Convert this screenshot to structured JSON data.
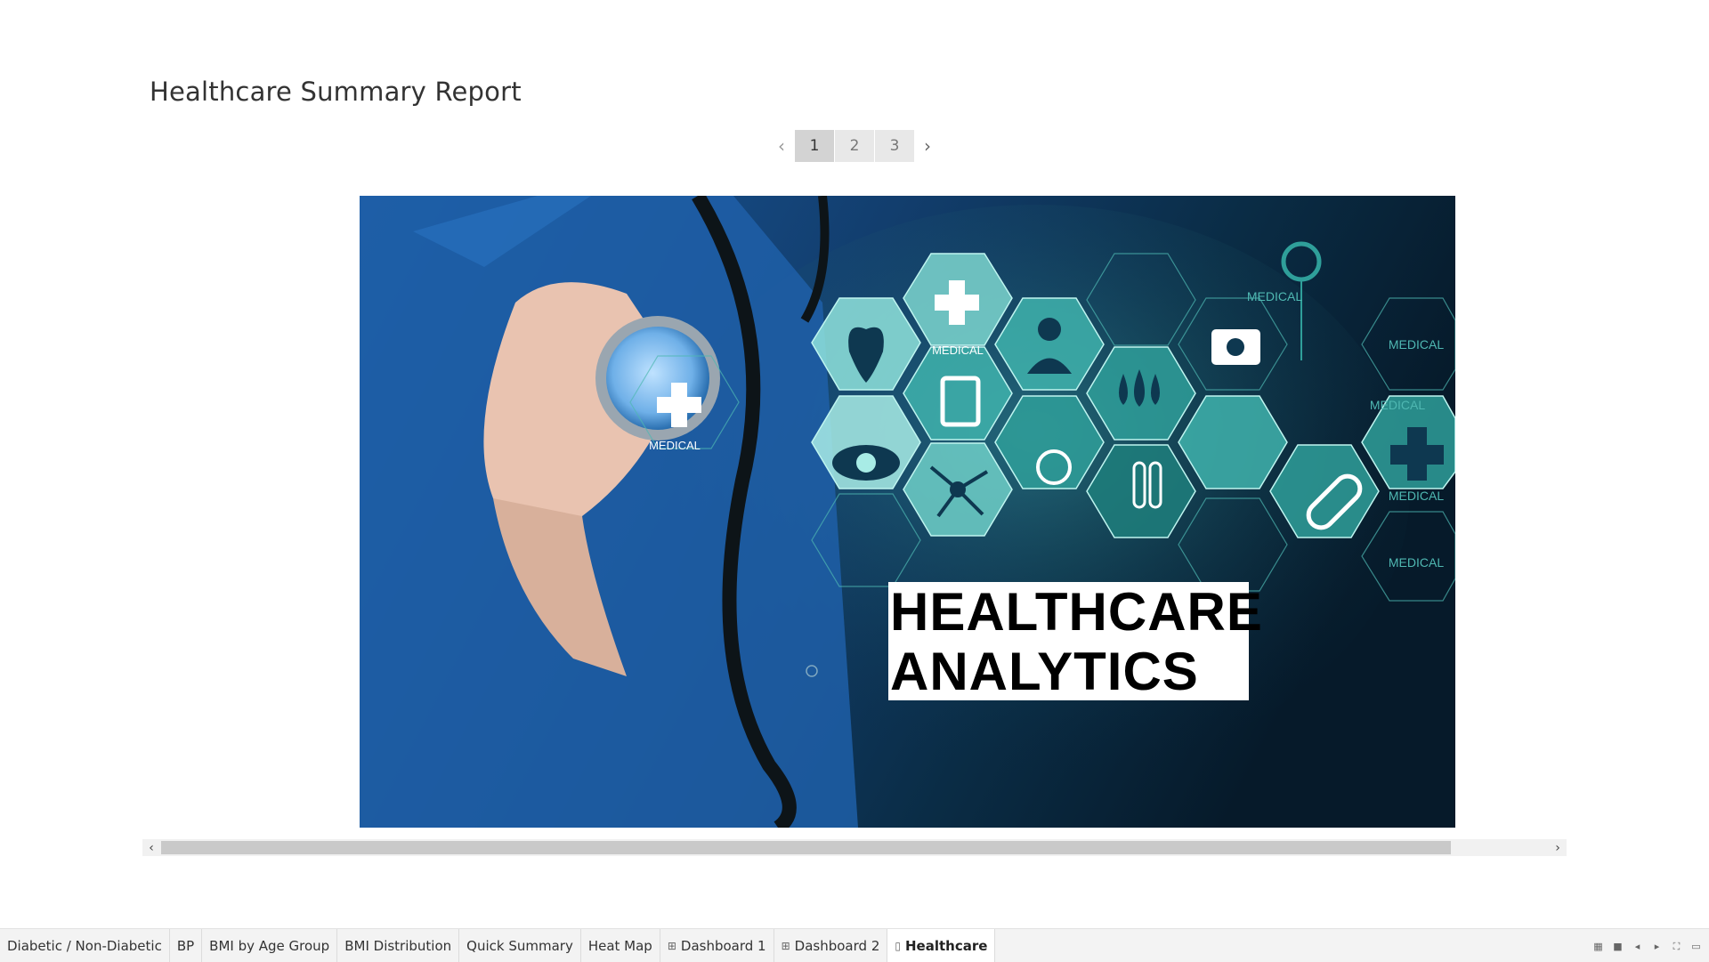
{
  "report": {
    "title": "Healthcare Summary Report"
  },
  "pager": {
    "prev": "‹",
    "next": "›",
    "pages": [
      "1",
      "2",
      "3"
    ],
    "current": "1"
  },
  "hero": {
    "headline_line1": "HEALTHCARE",
    "headline_line2": "ANALYTICS",
    "hex_labels": [
      "MEDICAL",
      "MEDICAL",
      "MEDICAL",
      "MEDICAL",
      "MEDICAL",
      "MEDICAL",
      "MEDICAL"
    ],
    "colors": {
      "bg_dark": "#061627",
      "scrubs": "#1e5fa8",
      "teal": "#3fb3ad"
    }
  },
  "scrollbar": {
    "left": "‹",
    "right": "›"
  },
  "tabs": [
    {
      "label": "Diabetic / Non-Diabetic",
      "icon": ""
    },
    {
      "label": "BP",
      "icon": ""
    },
    {
      "label": "BMI by Age Group",
      "icon": ""
    },
    {
      "label": "BMI Distribution",
      "icon": ""
    },
    {
      "label": "Quick Summary",
      "icon": ""
    },
    {
      "label": "Heat Map",
      "icon": ""
    },
    {
      "label": "Dashboard 1",
      "icon": "dashboard-icon"
    },
    {
      "label": "Dashboard 2",
      "icon": "dashboard-icon"
    },
    {
      "label": "Healthcare",
      "icon": "story-icon",
      "active": true
    }
  ],
  "status_icons": [
    "grid-view-icon",
    "single-view-icon",
    "prev-sheet-icon",
    "next-sheet-icon",
    "fullscreen-icon",
    "presentation-icon"
  ]
}
